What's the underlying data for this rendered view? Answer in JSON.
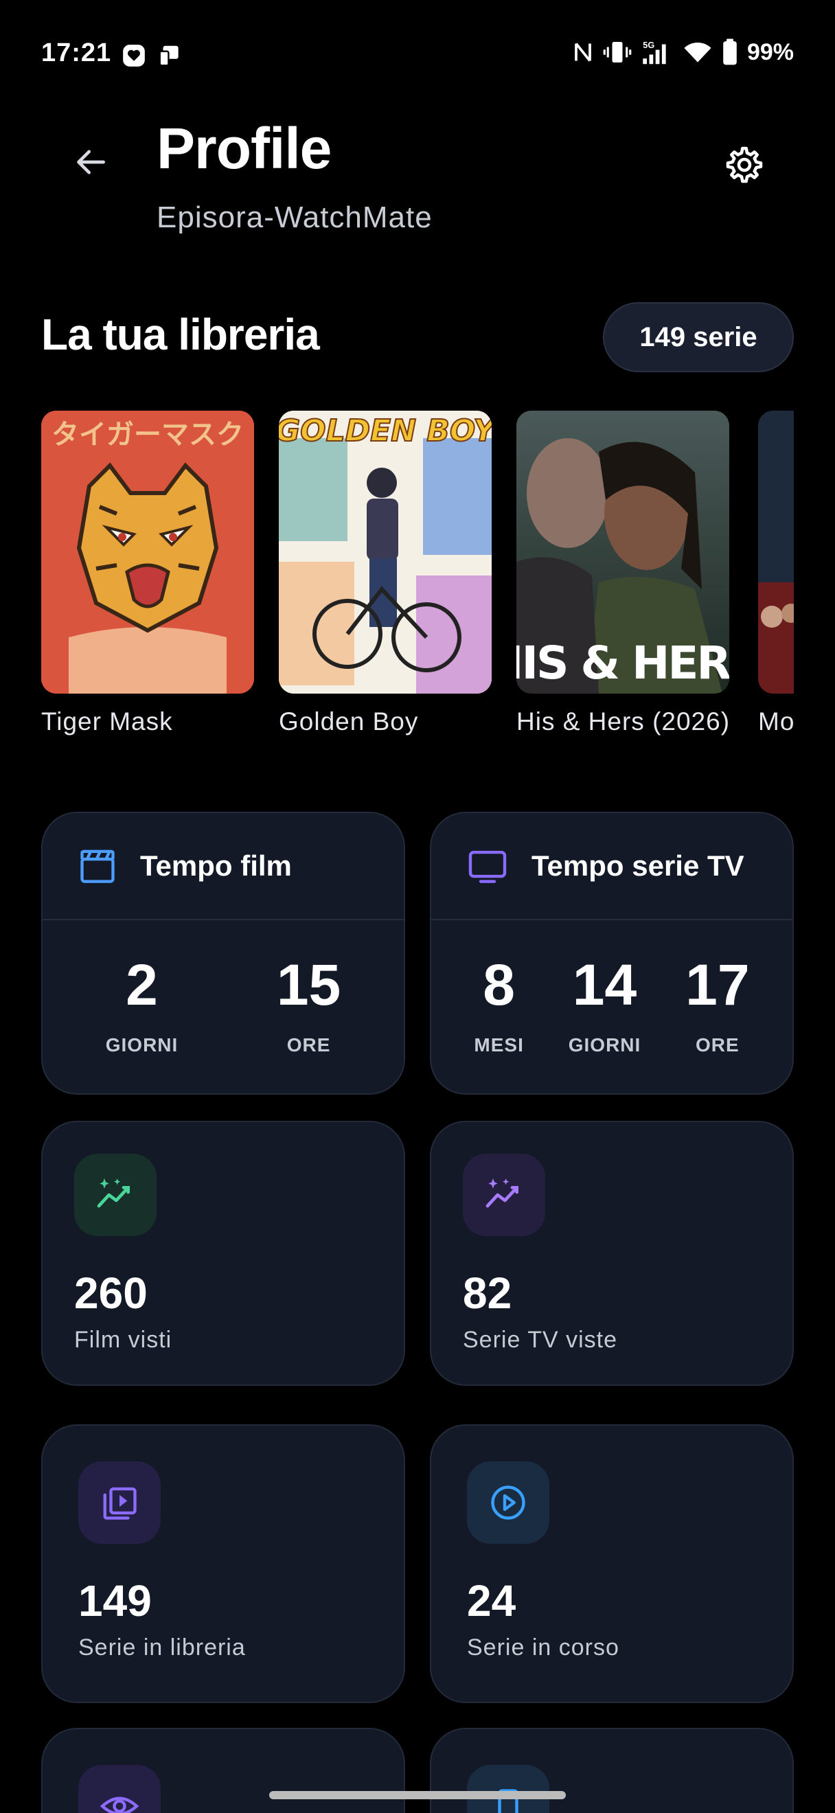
{
  "status": {
    "time": "17:21",
    "battery": "99%",
    "network": "5G"
  },
  "header": {
    "title": "Profile",
    "subtitle": "Episora-WatchMate"
  },
  "library": {
    "title": "La tua libreria",
    "count": "149 serie",
    "items": [
      {
        "label": "Tiger Mask"
      },
      {
        "label": "Golden Boy"
      },
      {
        "label": "His & Hers (2026)"
      },
      {
        "label": "Mo"
      }
    ],
    "poster_texts": [
      "タイガーマスク",
      "GOLDEN BOY",
      "HIS & HERS"
    ]
  },
  "time_cards": [
    {
      "label": "Tempo film",
      "stats": [
        {
          "value": "2",
          "unit": "GIORNI"
        },
        {
          "value": "15",
          "unit": "ORE"
        }
      ]
    },
    {
      "label": "Tempo serie TV",
      "stats": [
        {
          "value": "8",
          "unit": "MESI"
        },
        {
          "value": "14",
          "unit": "GIORNI"
        },
        {
          "value": "17",
          "unit": "ORE"
        }
      ]
    }
  ],
  "stats": [
    {
      "value": "260",
      "label": "Film visti",
      "icon": "trending-sparkle-icon",
      "color": "#4ad59a"
    },
    {
      "value": "82",
      "label": "Serie TV viste",
      "icon": "trending-sparkle-icon",
      "color": "#a77cff"
    },
    {
      "value": "149",
      "label": "Serie in libreria",
      "icon": "library-play-icon",
      "color": "#8c6bff"
    },
    {
      "value": "24",
      "label": "Serie in corso",
      "icon": "play-circle-icon",
      "color": "#3aa0ff"
    }
  ],
  "colors": {
    "background": "#000000",
    "card": "#131926",
    "accent_blue": "#4b9dff",
    "accent_purple": "#8a6bff"
  }
}
